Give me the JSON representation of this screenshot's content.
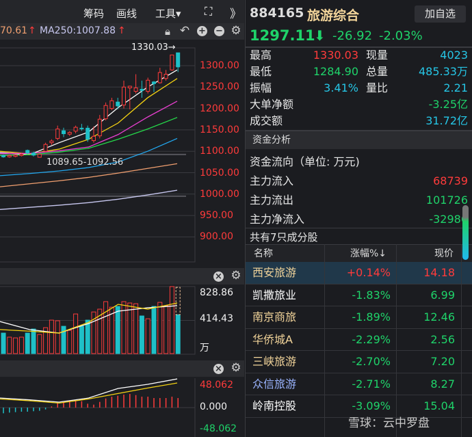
{
  "toolbar": {
    "chips": "筹码",
    "draw": "画线",
    "tools": "工具▾",
    "fullscreen_icon": "expand-icon",
    "more": "》"
  },
  "ma_bar": {
    "ma_prev": "70.61",
    "ma250_label": "MA250:1007.88",
    "arrow": "↑"
  },
  "price_axis": [
    "1300.00",
    "1250.00",
    "1200.00",
    "1150.00",
    "1100.00",
    "1050.00",
    "1000.00",
    "950.00",
    "900.00"
  ],
  "high_marker": "1330.03→",
  "chip_range": "1089.65-1092.56",
  "volume_axis": {
    "top": "828.86",
    "mid": "414.43",
    "unit": "万"
  },
  "macd_axis": {
    "top": "48.062",
    "mid": "0.000",
    "bottom": "-48.062"
  },
  "header": {
    "code": "884165",
    "name": "旅游综合",
    "watch_button": "加自选",
    "price": "1297.11",
    "arrow": "⬇",
    "change": "-26.92",
    "change_pct": "-2.03%"
  },
  "stats": [
    {
      "label": "最高",
      "value": "1330.03",
      "color": "red",
      "label2": "现量",
      "value2": "4023"
    },
    {
      "label": "最低",
      "value": "1284.90",
      "color": "green",
      "label2": "总量",
      "value2": "485.33万"
    },
    {
      "label": "振幅",
      "value": "3.41%",
      "color": "cyan",
      "label2": "量比",
      "value2": "2.21"
    }
  ],
  "big_order": {
    "label": "大单净额",
    "value": "-3.25亿"
  },
  "turnover": {
    "label": "成交额",
    "value": "31.72亿"
  },
  "fund": {
    "title": "资金分析",
    "unit_label": "资金流向（单位: 万元)",
    "inflow_label": "主力流入",
    "inflow": "68739",
    "outflow_label": "主力流出",
    "outflow": "101726",
    "net_label": "主力净流入",
    "net": "-32986"
  },
  "components": {
    "title": "共有7只成分股",
    "headers": [
      "名称",
      "涨幅%↓",
      "现价"
    ],
    "rows": [
      {
        "name": "西安旅游",
        "pct": "+0.14%",
        "price": "14.18"
      },
      {
        "name": "凯撒旅业",
        "pct": "-1.83%",
        "price": "6.99"
      },
      {
        "name": "南京商旅",
        "pct": "-1.89%",
        "price": "12.46"
      },
      {
        "name": "华侨城A",
        "pct": "-2.29%",
        "price": "2.56"
      },
      {
        "name": "三峡旅游",
        "pct": "-2.70%",
        "price": "7.20"
      },
      {
        "name": "众信旅游",
        "pct": "-2.71%",
        "price": "8.27"
      },
      {
        "name": "岭南控股",
        "pct": "-3.09%",
        "price": "15.04"
      }
    ]
  },
  "watermark": "雪球：云中罗盘",
  "colors": {
    "up": "#ff3b3b",
    "down": "#1fc0c8",
    "green": "#1fd36a",
    "cyan": "#26c6e6"
  },
  "chart_data": {
    "type": "candlestick",
    "candles": [
      [
        1090,
        1092,
        1085,
        1087
      ],
      [
        1087,
        1092,
        1085,
        1090
      ],
      [
        1088,
        1093,
        1086,
        1091
      ],
      [
        1090,
        1096,
        1088,
        1093
      ],
      [
        1102,
        1104,
        1093,
        1096
      ],
      [
        1096,
        1099,
        1088,
        1091
      ],
      [
        1086,
        1094,
        1085,
        1093
      ],
      [
        1100,
        1120,
        1098,
        1116
      ],
      [
        1120,
        1128,
        1115,
        1124
      ],
      [
        1130,
        1160,
        1126,
        1152
      ],
      [
        1148,
        1155,
        1133,
        1141
      ],
      [
        1140,
        1147,
        1136,
        1144
      ],
      [
        1147,
        1160,
        1142,
        1156
      ],
      [
        1154,
        1164,
        1148,
        1153
      ],
      [
        1154,
        1160,
        1122,
        1128
      ],
      [
        1125,
        1158,
        1120,
        1135
      ],
      [
        1136,
        1185,
        1130,
        1175
      ],
      [
        1176,
        1214,
        1172,
        1207
      ],
      [
        1200,
        1225,
        1196,
        1218
      ],
      [
        1215,
        1225,
        1198,
        1206
      ],
      [
        1208,
        1265,
        1200,
        1250
      ],
      [
        1248,
        1253,
        1198,
        1252
      ],
      [
        1240,
        1280,
        1235,
        1248
      ],
      [
        1245,
        1265,
        1225,
        1242
      ],
      [
        1240,
        1272,
        1235,
        1266
      ],
      [
        1262,
        1264,
        1238,
        1258
      ],
      [
        1260,
        1295,
        1258,
        1284
      ],
      [
        1270,
        1290,
        1265,
        1280
      ],
      [
        1290,
        1325,
        1288,
        1325
      ],
      [
        1330.03,
        1330.03,
        1284.9,
        1297.11
      ]
    ],
    "ma": [
      {
        "name": "MA5",
        "color": "#ffffff",
        "values": [
          1097,
          1092,
          1120,
          1145,
          1202,
          1250,
          1290
        ]
      },
      {
        "name": "MA10",
        "color": "#f5d312",
        "values": [
          1100,
          1094,
          1105,
          1128,
          1166,
          1225,
          1270
        ]
      },
      {
        "name": "MA20",
        "color": "#e83fd0",
        "values": [
          1095,
          1095,
          1101,
          1110,
          1139,
          1180,
          1217
        ]
      },
      {
        "name": "MA30",
        "color": "#25d84a",
        "values": [
          1090,
          1092,
          1098,
          1107,
          1128,
          1152,
          1179
        ]
      },
      {
        "name": "MA60",
        "color": "#22a8f0",
        "values": [
          1043,
          1048,
          1054,
          1062,
          1075,
          1100,
          1130
        ]
      },
      {
        "name": "MA120",
        "color": "#f2a070",
        "values": [
          1017,
          1024,
          1031,
          1039,
          1049,
          1060,
          1071
        ]
      },
      {
        "name": "MA250",
        "color": "#c8c8f0",
        "values": [
          964,
          969,
          974,
          980,
          988,
          998,
          1009
        ]
      }
    ],
    "price_range": [
      870,
      1360
    ],
    "volume": [
      256,
      205,
      196,
      205,
      256,
      307,
      239,
      324,
      418,
      410,
      341,
      290,
      495,
      341,
      418,
      520,
      555,
      649,
      580,
      589,
      649,
      632,
      623,
      470,
      435,
      589,
      640,
      598,
      837,
      486
    ],
    "volume_ma": [
      {
        "color": "#ffffff",
        "values": [
          400,
          300,
          256,
          375,
          530,
          572,
          598
        ]
      },
      {
        "color": "#f5d312",
        "values": [
          300,
          280,
          256,
          390,
          615,
          555,
          632
        ]
      }
    ],
    "volume_max": 828.86,
    "macd_hist": [
      -12.5,
      -11,
      -10,
      -9,
      -9,
      -8,
      -7,
      -4,
      2.5,
      10,
      12.5,
      14,
      15,
      14,
      8.5,
      6.5,
      12.5,
      20,
      24,
      26,
      28.5,
      30,
      27.5,
      24,
      24,
      21,
      21,
      21,
      24,
      21
    ],
    "dif": [
      21,
      17,
      12,
      21,
      42,
      51,
      63
    ],
    "dea": [
      19,
      15,
      10,
      19,
      31,
      43,
      54
    ],
    "macd_range": [
      -48.062,
      48.062
    ]
  }
}
